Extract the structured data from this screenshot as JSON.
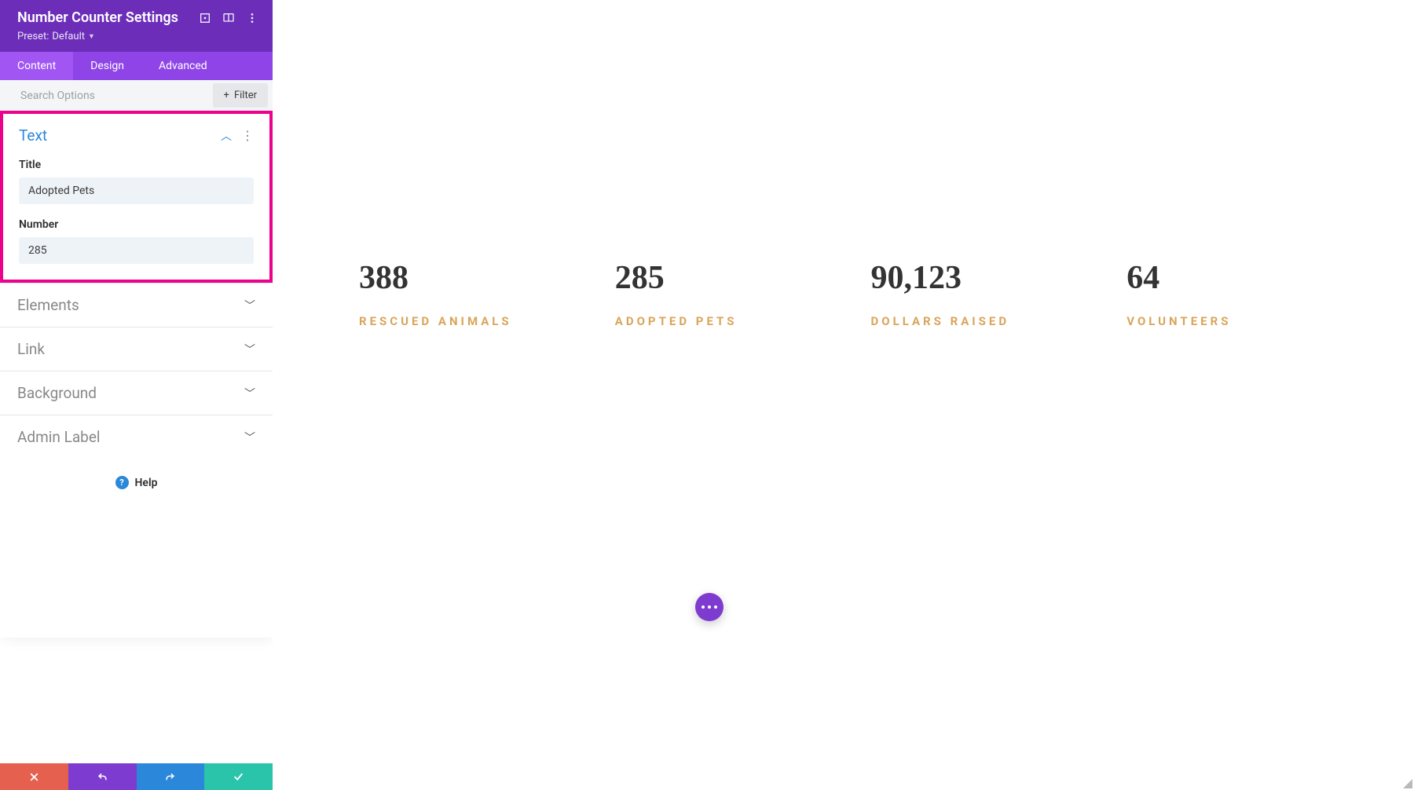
{
  "panel": {
    "title": "Number Counter Settings",
    "preset_prefix": "Preset:",
    "preset_value": "Default",
    "tabs": [
      "Content",
      "Design",
      "Advanced"
    ],
    "active_tab": 0,
    "search_placeholder": "Search Options",
    "filter_label": "Filter",
    "text_section": {
      "title": "Text",
      "fields": {
        "title_label": "Title",
        "title_value": "Adopted Pets",
        "number_label": "Number",
        "number_value": "285"
      }
    },
    "collapsed_sections": [
      "Elements",
      "Link",
      "Background",
      "Admin Label"
    ],
    "help_label": "Help"
  },
  "canvas": {
    "counters": [
      {
        "value": "388",
        "label": "RESCUED ANIMALS"
      },
      {
        "value": "285",
        "label": "ADOPTED PETS"
      },
      {
        "value": "90,123",
        "label": "DOLLARS RAISED"
      },
      {
        "value": "64",
        "label": "VOLUNTEERS"
      }
    ]
  },
  "colors": {
    "header_purple": "#6c2eb9",
    "tab_purple": "#8e44e6",
    "tab_active": "#a156f4",
    "highlight_pink": "#ec008c",
    "link_blue": "#2b87da",
    "counter_label": "#d9a55a",
    "cancel": "#e6604f",
    "undo": "#7e3bd0",
    "redo": "#2b87da",
    "save": "#29c4a9"
  }
}
